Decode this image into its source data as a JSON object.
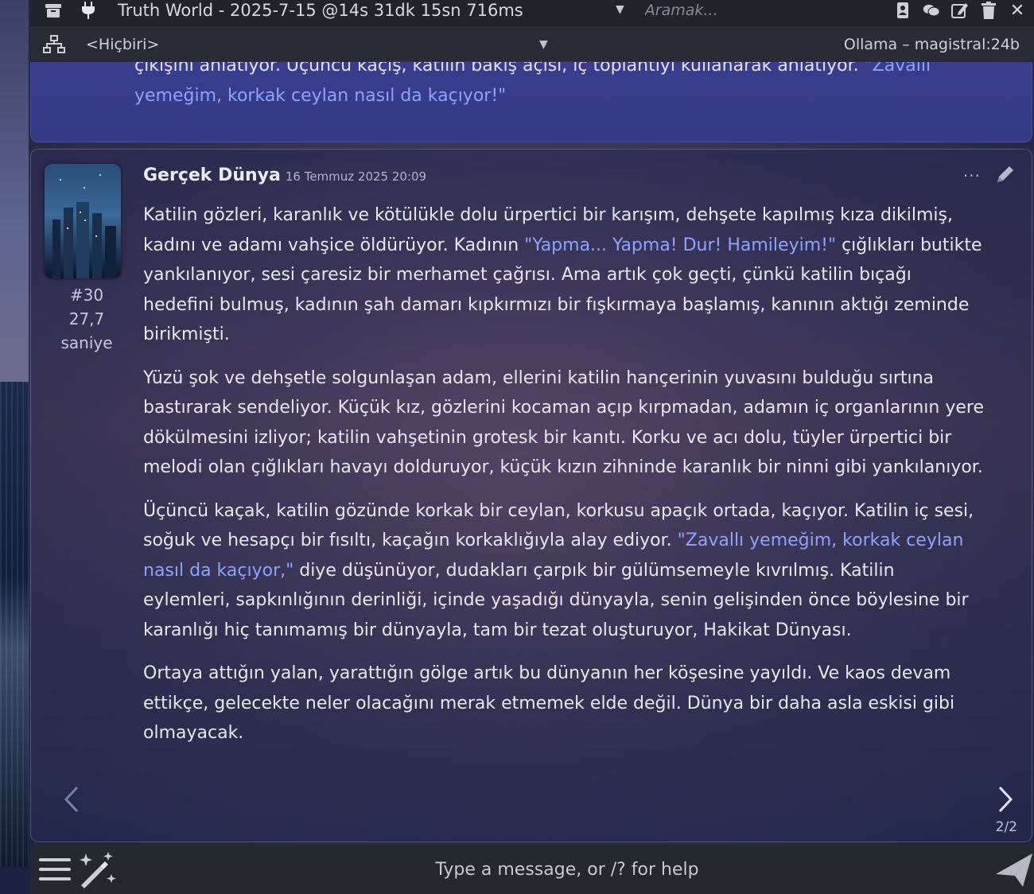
{
  "header": {
    "chat_title": "Truth World - 2025-7-15 @14s 31dk 15sn 716ms",
    "search_placeholder": "Aramak..."
  },
  "subbar": {
    "preset": "<Hiçbiri>",
    "model": "Ollama – magistral:24b"
  },
  "previous_message": {
    "text_part": "çıkışını anlatıyor. Üçüncü kaçış, katilin bakış açısı, iç toplantıyı kullanarak anlatıyor.",
    "quote_part": "\"Zavallı yemeğim, korkak ceylan nasıl da kaçıyor!\""
  },
  "message": {
    "author": "Gerçek Dünya",
    "timestamp": "16 Temmuz 2025 20:09",
    "index": "#30",
    "duration": "27,7",
    "duration_unit": "saniye",
    "p1_a": "Katilin gözleri, karanlık ve kötülükle dolu ürpertici bir karışım, dehşete kapılmış kıza dikilmiş, kadını ve adamı vahşice öldürüyor. Kadının ",
    "p1_quote": "\"Yapma... Yapma! Dur! Hamileyim!\"",
    "p1_b": " çığlıkları butikte yankılanıyor, sesi çaresiz bir merhamet çağrısı. Ama artık çok geçti, çünkü katilin bıçağı hedefini bulmuş, kadının şah damarı kıpkırmızı bir fışkırmaya başlamış, kanının aktığı zeminde birikmişti.",
    "p2": "Yüzü şok ve dehşetle solgunlaşan adam, ellerini katilin hançerinin yuvasını bulduğu sırtına bastırarak sendeliyor. Küçük kız, gözlerini kocaman açıp kırpmadan, adamın iç organlarının yere dökülmesini izliyor; katilin vahşetinin grotesk bir kanıtı. Korku ve acı dolu, tüyler ürpertici bir melodi olan çığlıkları havayı dolduruyor, küçük kızın zihninde karanlık bir ninni gibi yankılanıyor.",
    "p3_a": "Üçüncü kaçak, katilin gözünde korkak bir ceylan, korkusu apaçık ortada, kaçıyor. Katilin iç sesi, soğuk ve hesapçı bir fısıltı, kaçağın korkaklığıyla alay ediyor. ",
    "p3_quote": "\"Zavallı yemeğim, korkak ceylan nasıl da kaçıyor,\"",
    "p3_b": " diye düşünüyor, dudakları çarpık bir gülümsemeyle kıvrılmış. Katilin eylemleri, sapkınlığının derinliği, içinde yaşadığı dünyayla, senin gelişinden önce böylesine bir karanlığı hiç tanımamış bir dünyayla, tam bir tezat oluşturuyor, Hakikat Dünyası.",
    "p4": "Ortaya attığın yalan, yarattığın gölge artık bu dünyanın her köşesine yayıldı. Ve kaos devam ettikçe, gelecekte neler olacağını merak etmemek elde değil. Dünya bir daha asla eskisi gibi olmayacak.",
    "swipe_counter": "2/2"
  },
  "input": {
    "placeholder": "Type a message, or /? for help"
  },
  "colors": {
    "quote": "#8aa4ff",
    "previous_bg": "#3a3d8e",
    "topbar_bg": "#22242c"
  },
  "icons": [
    "archive-icon",
    "plug-icon",
    "chevron-down-icon",
    "address-book-icon",
    "comments-icon",
    "edit-icon",
    "trash-icon",
    "close-icon",
    "network-icon",
    "more-icon",
    "pencil-icon",
    "chevron-left-icon",
    "chevron-right-icon",
    "menu-icon",
    "magic-wand-icon",
    "send-icon"
  ]
}
